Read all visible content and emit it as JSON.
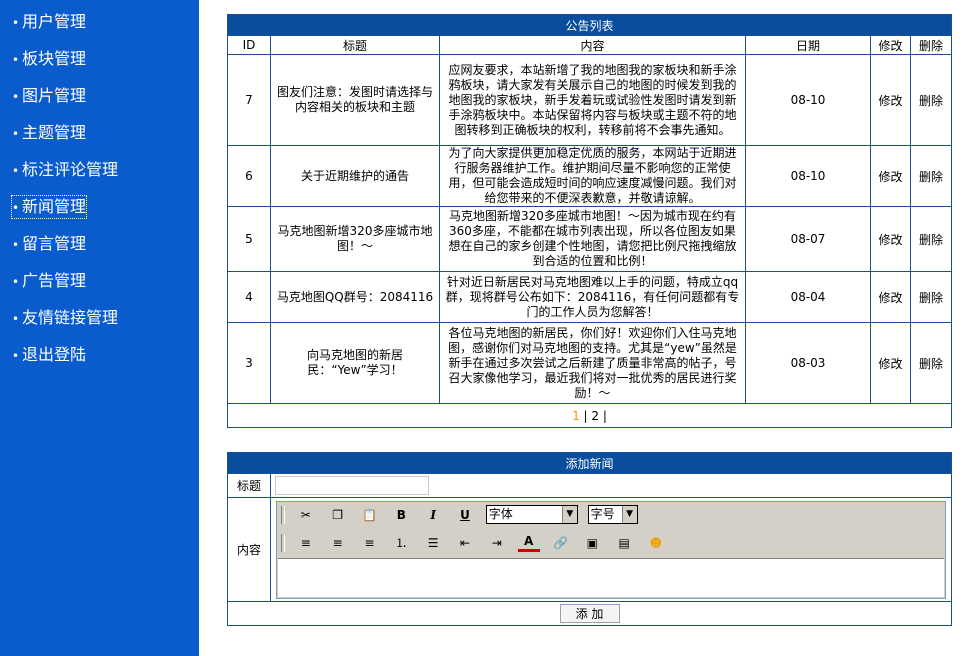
{
  "sidebar": {
    "items": [
      {
        "label": "用户管理"
      },
      {
        "label": "板块管理"
      },
      {
        "label": "图片管理"
      },
      {
        "label": "主题管理"
      },
      {
        "label": "标注评论管理"
      },
      {
        "label": "新闻管理",
        "active": true
      },
      {
        "label": "留言管理"
      },
      {
        "label": "广告管理"
      },
      {
        "label": "友情链接管理"
      },
      {
        "label": "退出登陆"
      }
    ]
  },
  "announcements": {
    "title": "公告列表",
    "columns": [
      "ID",
      "标题",
      "内容",
      "日期",
      "修改",
      "删除"
    ],
    "rows": [
      {
        "id": "7",
        "title": "图友们注意：发图时请选择与内容相关的板块和主题",
        "content": "应网友要求，本站新增了我的地图我的家板块和新手涂鸦板块，请大家发有关展示自己的地图的时候发到我的地图我的家板块，新手发着玩或试验性发图时请发到新手涂鸦板块中。本站保留将内容与板块或主题不符的地图转移到正确板块的权利，转移前将不会事先通知。",
        "date": "08-10",
        "edit": "修改",
        "delete": "删除"
      },
      {
        "id": "6",
        "title": "关于近期维护的通告",
        "content": "为了向大家提供更加稳定优质的服务，本网站于近期进行服务器维护工作。维护期间尽量不影响您的正常使用，但可能会造成短时间的响应速度减慢问题。我们对给您带来的不便深表歉意，并敬请谅解。",
        "date": "08-10",
        "edit": "修改",
        "delete": "删除"
      },
      {
        "id": "5",
        "title": "马克地图新增320多座城市地图！～",
        "content": "马克地图新增320多座城市地图！～因为城市现在约有360多座，不能都在城市列表出现，所以各位图友如果想在自己的家乡创建个性地图，请您把比例尺拖拽缩放到合适的位置和比例！",
        "date": "08-07",
        "edit": "修改",
        "delete": "删除"
      },
      {
        "id": "4",
        "title": "马克地图QQ群号：2084116",
        "content": "针对近日新居民对马克地图难以上手的问题，特成立qq群，现将群号公布如下：2084116，有任何问题都有专门的工作人员为您解答！",
        "date": "08-04",
        "edit": "修改",
        "delete": "删除"
      },
      {
        "id": "3",
        "title": "向马克地图的新居民：“Yew”学习！",
        "content": "各位马克地图的新居民，你们好！欢迎你们入住马克地图，感谢你们对马克地图的支持。尤其是“yew”虽然是新手在通过多次尝试之后新建了质量非常高的帖子，号召大家像他学习，最近我们将对一批优秀的居民进行奖励！～",
        "date": "08-03",
        "edit": "修改",
        "delete": "删除"
      }
    ],
    "pager": {
      "current": "1",
      "sep": "|",
      "next": "2",
      "tail": "|"
    }
  },
  "add_news": {
    "title": "添加新闻",
    "title_label": "标题",
    "title_value": "",
    "content_label": "内容",
    "font_select": "字体",
    "size_select": "字号",
    "submit_label": "添 加"
  },
  "toolbar": {
    "row1": [
      "cut-icon",
      "copy-icon",
      "paste-icon",
      "bold-icon",
      "italic-icon",
      "underline-icon"
    ],
    "row2": [
      "align-left-icon",
      "align-center-icon",
      "align-right-icon",
      "ordered-list-icon",
      "unordered-list-icon",
      "outdent-icon",
      "indent-icon",
      "font-color-icon",
      "link-icon",
      "image-icon",
      "horizontal-rule-icon",
      "emoticon-icon"
    ]
  },
  "colors": {
    "sidebar_bg": "#0a5ccd",
    "header_bg": "#0a4d9c",
    "border": "#1a4f93",
    "pager_current": "#ff8c00"
  }
}
